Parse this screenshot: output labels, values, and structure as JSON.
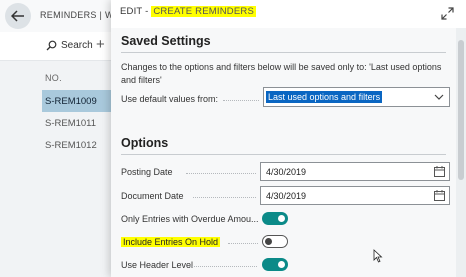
{
  "background_page": {
    "title": "REMINDERS | WOR",
    "search_label": "Search",
    "add_label": "+",
    "column_header": "NO.",
    "rows": [
      "S-REM1009",
      "S-REM1011",
      "S-REM1012"
    ]
  },
  "dialog": {
    "caption_prefix": "EDIT - ",
    "caption_highlight": "CREATE REMINDERS",
    "saved_settings": {
      "title": "Saved Settings",
      "info": "Changes to the options and filters below will be saved only to: 'Last used options and filters'",
      "default_values_label": "Use default values from:",
      "default_values_value": "Last used options and filters"
    },
    "options": {
      "title": "Options",
      "posting_date_label": "Posting Date",
      "posting_date_value": "4/30/2019",
      "document_date_label": "Document Date",
      "document_date_value": "4/30/2019",
      "overdue_label": "Only Entries with Overdue Amou...",
      "overdue_on": true,
      "on_hold_label": "Include Entries On Hold",
      "on_hold_on": false,
      "header_level_label": "Use Header Level",
      "header_level_on": true
    }
  },
  "colors": {
    "accent_teal": "#0b8a88",
    "highlight_yellow": "#ffff00",
    "selected_row": "#a9c9dc",
    "select_highlight": "#0a66c2"
  },
  "icons": [
    "back-arrow-icon",
    "search-icon",
    "expand-icon",
    "chevron-down-icon",
    "calendar-icon",
    "mouse-cursor-icon"
  ]
}
